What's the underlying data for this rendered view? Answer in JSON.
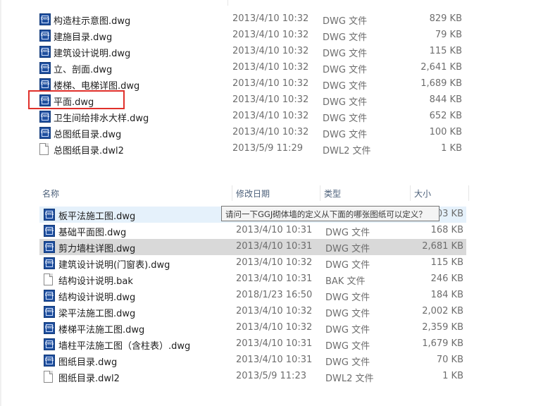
{
  "top_files": [
    {
      "name": "构造柱示意图.dwg",
      "date": "2013/4/10 10:32",
      "type": "DWG 文件",
      "size": "829 KB",
      "icon": "dwg-file-icon"
    },
    {
      "name": "建施目录.dwg",
      "date": "2013/4/10 10:32",
      "type": "DWG 文件",
      "size": "79 KB",
      "icon": "dwg-file-icon"
    },
    {
      "name": "建筑设计说明.dwg",
      "date": "2013/4/10 10:32",
      "type": "DWG 文件",
      "size": "115 KB",
      "icon": "dwg-file-icon"
    },
    {
      "name": "立、剖面.dwg",
      "date": "2013/4/10 10:32",
      "type": "DWG 文件",
      "size": "2,641 KB",
      "icon": "dwg-file-icon"
    },
    {
      "name": "楼梯、电梯详图.dwg",
      "date": "2013/4/10 10:32",
      "type": "DWG 文件",
      "size": "1,689 KB",
      "icon": "dwg-file-icon"
    },
    {
      "name": "平面.dwg",
      "date": "2013/4/10 10:32",
      "type": "DWG 文件",
      "size": "844 KB",
      "icon": "dwg-file-icon"
    },
    {
      "name": "卫生间给排水大样.dwg",
      "date": "2013/4/10 10:32",
      "type": "DWG 文件",
      "size": "652 KB",
      "icon": "dwg-file-icon"
    },
    {
      "name": "总图纸目录.dwg",
      "date": "2013/4/10 10:32",
      "type": "DWG 文件",
      "size": "100 KB",
      "icon": "dwg-file-icon"
    },
    {
      "name": "总图纸目录.dwl2",
      "date": "2013/5/9 11:29",
      "type": "DWL2 文件",
      "size": "1 KB",
      "icon": "blank-file-icon"
    }
  ],
  "columns": {
    "name": "名称",
    "date": "修改日期",
    "type": "类型",
    "size": "大小"
  },
  "bottom_files": [
    {
      "name": "板平法施工图.dwg",
      "date": "",
      "type": "",
      "size": "03 KB",
      "icon": "dwg-file-icon"
    },
    {
      "name": "基础平面图.dwg",
      "date": "2013/4/10 10:31",
      "type": "DWG 文件",
      "size": "168 KB",
      "icon": "dwg-file-icon"
    },
    {
      "name": "剪力墙柱详图.dwg",
      "date": "2013/4/10 10:31",
      "type": "DWG 文件",
      "size": "2,681 KB",
      "icon": "dwg-file-icon"
    },
    {
      "name": "建筑设计说明(门窗表).dwg",
      "date": "2013/4/10 10:32",
      "type": "DWG 文件",
      "size": "115 KB",
      "icon": "dwg-file-icon"
    },
    {
      "name": "结构设计说明.bak",
      "date": "2013/4/10 10:31",
      "type": "BAK 文件",
      "size": "246 KB",
      "icon": "blank-file-icon"
    },
    {
      "name": "结构设计说明.dwg",
      "date": "2018/1/23 16:50",
      "type": "DWG 文件",
      "size": "184 KB",
      "icon": "dwg-file-icon"
    },
    {
      "name": "梁平法施工图.dwg",
      "date": "2013/4/10 10:32",
      "type": "DWG 文件",
      "size": "2,002 KB",
      "icon": "dwg-file-icon"
    },
    {
      "name": "楼梯平法施工图.dwg",
      "date": "2013/4/10 10:32",
      "type": "DWG 文件",
      "size": "2,359 KB",
      "icon": "dwg-file-icon"
    },
    {
      "name": "墙柱平法施工图（含柱表）.dwg",
      "date": "2013/4/10 10:31",
      "type": "DWG 文件",
      "size": "1,679 KB",
      "icon": "dwg-file-icon"
    },
    {
      "name": "图纸目录.dwg",
      "date": "2013/4/10 10:31",
      "type": "DWG 文件",
      "size": "70 KB",
      "icon": "dwg-file-icon"
    },
    {
      "name": "图纸目录.dwl2",
      "date": "2013/5/9 11:23",
      "type": "DWL2 文件",
      "size": "1 KB",
      "icon": "blank-file-icon"
    }
  ],
  "tooltip": "请问一下GGJ砌体墙的定义从下面的哪张图纸可以定义？",
  "colors": {
    "highlight": "#e0302b",
    "hover_row": "#e5f1fb",
    "selected_row": "#d9d9d9"
  }
}
